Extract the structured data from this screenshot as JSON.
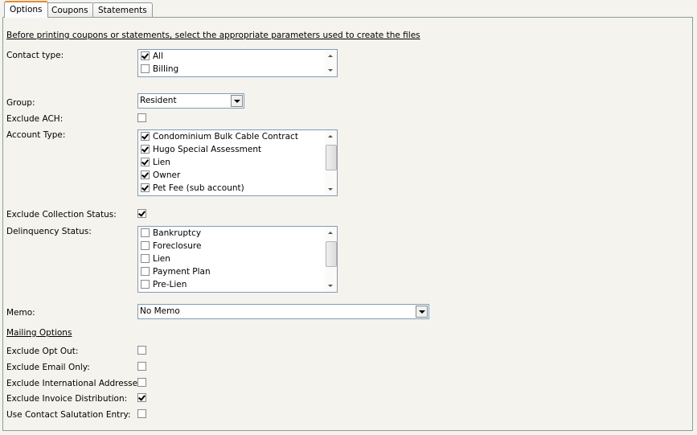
{
  "tabs": [
    {
      "label": "Options",
      "active": true
    },
    {
      "label": "Coupons"
    },
    {
      "label": "Statements"
    }
  ],
  "intro": "Before printing coupons or statements, select the appropriate parameters used to create the files",
  "contact_type": {
    "label": "Contact type:",
    "items": [
      {
        "label": "All",
        "checked": true
      },
      {
        "label": "Billing",
        "checked": false
      }
    ]
  },
  "group": {
    "label": "Group:",
    "value": "Resident"
  },
  "exclude_ach": {
    "label": "Exclude ACH:",
    "checked": false
  },
  "account_type": {
    "label": "Account Type:",
    "items": [
      {
        "label": "Condominium Bulk Cable Contract",
        "checked": true
      },
      {
        "label": "Hugo Special Assessment",
        "checked": true
      },
      {
        "label": "Lien",
        "checked": true
      },
      {
        "label": "Owner",
        "checked": true
      },
      {
        "label": "Pet Fee (sub account)",
        "checked": true
      }
    ]
  },
  "exclude_collection": {
    "label": "Exclude Collection Status:",
    "checked": true
  },
  "delinquency": {
    "label": "Delinquency Status:",
    "items": [
      {
        "label": "Bankruptcy",
        "checked": false
      },
      {
        "label": "Foreclosure",
        "checked": false
      },
      {
        "label": "Lien",
        "checked": false
      },
      {
        "label": "Payment Plan",
        "checked": false
      },
      {
        "label": "Pre-Lien",
        "checked": false
      }
    ]
  },
  "memo": {
    "label": "Memo:",
    "value": "No Memo"
  },
  "mailing": {
    "title": "Mailing Options",
    "options": [
      {
        "label": "Exclude Opt Out:",
        "checked": false
      },
      {
        "label": "Exclude Email Only:",
        "checked": false
      },
      {
        "label": "Exclude  International Addresse",
        "checked": false
      },
      {
        "label": "Exclude Invoice Distribution:",
        "checked": true
      },
      {
        "label": "Use Contact Salutation Entry:",
        "checked": false
      }
    ]
  }
}
